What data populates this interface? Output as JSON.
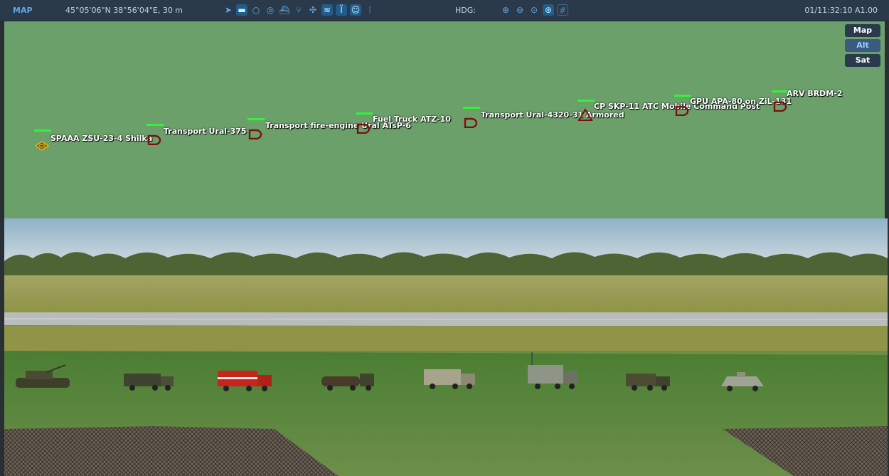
{
  "topbar": {
    "title": "MAP",
    "coordinates": "45°05'06\"N 38°56'04\"E, 30 m",
    "heading_label": "HDG:",
    "clock": "01/11:32:10 A1.00",
    "tools": [
      "select-arrow-icon",
      "measure-ruler-icon",
      "circle-icon",
      "layers-icon",
      "ship-icon",
      "route-icon",
      "target-icon",
      "radio-icon",
      "tower-icon",
      "chat-icon",
      "units-icon"
    ],
    "zoom_tools": [
      "zoom-in-icon",
      "zoom-out-icon",
      "zoom-fit-icon",
      "globe-icon",
      "grid-icon"
    ],
    "accent_color": "#5aaeea"
  },
  "map_layers": [
    "Map",
    "Alt",
    "Sat"
  ],
  "map_layer_selected": "Alt",
  "units": [
    {
      "label": "SPAAA ZSU-23-4 Shilka",
      "type": "air-defense"
    },
    {
      "label": "Transport Ural-375",
      "type": "vehicle"
    },
    {
      "label": "Transport fire-engine Ural ATsP-6",
      "type": "vehicle"
    },
    {
      "label": "Fuel Truck ATZ-10",
      "type": "vehicle"
    },
    {
      "label": "Transport Ural-4320-31 Armored",
      "type": "vehicle"
    },
    {
      "label": "CP SKP-11 ATC Mobile Command Post",
      "type": "command"
    },
    {
      "label": "GPU APA-80 on ZiL-131",
      "type": "vehicle"
    },
    {
      "label": "ARV BRDM-2",
      "type": "vehicle"
    }
  ],
  "colors": {
    "map_terrain": "#6ba06a",
    "health_bar": "#34f23a",
    "unit_symbol": "#7a1010"
  }
}
